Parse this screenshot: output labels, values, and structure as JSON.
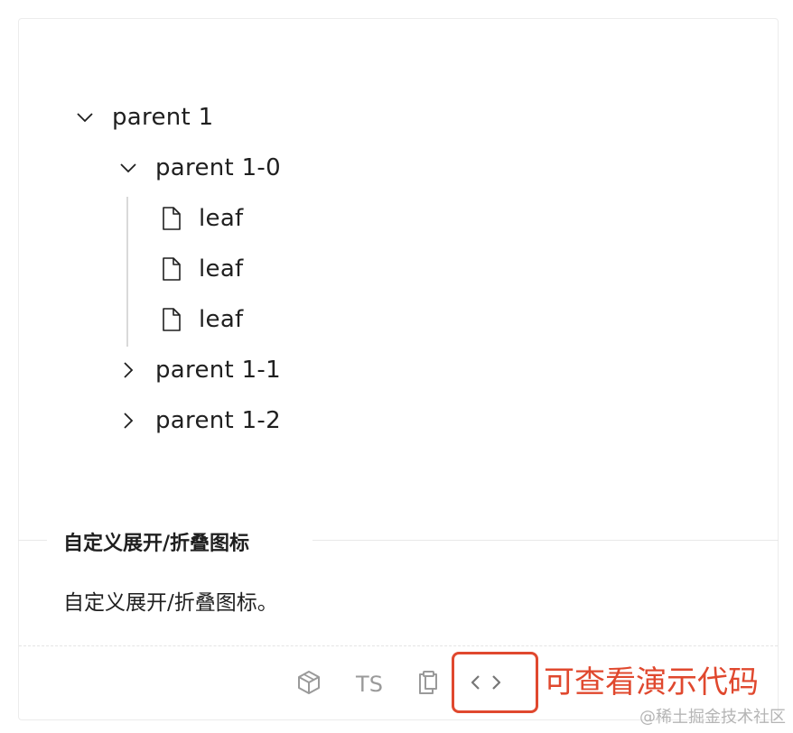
{
  "tree": {
    "nodes": [
      {
        "title": "parent 1",
        "type": "parent",
        "expanded": true
      },
      {
        "title": "parent 1-0",
        "type": "parent",
        "expanded": true
      },
      {
        "title": "leaf",
        "type": "leaf"
      },
      {
        "title": "leaf",
        "type": "leaf"
      },
      {
        "title": "leaf",
        "type": "leaf"
      },
      {
        "title": "parent 1-1",
        "type": "parent",
        "expanded": false
      },
      {
        "title": "parent 1-2",
        "type": "parent",
        "expanded": false
      }
    ]
  },
  "section": {
    "title": "自定义展开/折叠图标",
    "description": "自定义展开/折叠图标。"
  },
  "actions": {
    "ts_label": "TS",
    "icons": [
      "codesandbox-icon",
      "copy-icon",
      "code-icon"
    ]
  },
  "annotation": "可查看演示代码",
  "watermark": "@稀土掘金技术社区",
  "colors": {
    "annotation_red": "#e0482e",
    "muted_icon": "#9a9a9a",
    "indent_line": "#d9d9d9"
  }
}
